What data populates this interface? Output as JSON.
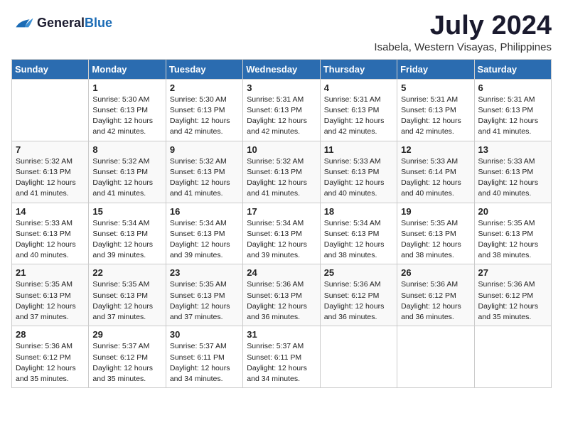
{
  "logo": {
    "line1": "General",
    "line2": "Blue"
  },
  "title": "July 2024",
  "location": "Isabela, Western Visayas, Philippines",
  "weekdays": [
    "Sunday",
    "Monday",
    "Tuesday",
    "Wednesday",
    "Thursday",
    "Friday",
    "Saturday"
  ],
  "weeks": [
    [
      {
        "day": "",
        "sunrise": "",
        "sunset": "",
        "daylight": ""
      },
      {
        "day": "1",
        "sunrise": "Sunrise: 5:30 AM",
        "sunset": "Sunset: 6:13 PM",
        "daylight": "Daylight: 12 hours and 42 minutes."
      },
      {
        "day": "2",
        "sunrise": "Sunrise: 5:30 AM",
        "sunset": "Sunset: 6:13 PM",
        "daylight": "Daylight: 12 hours and 42 minutes."
      },
      {
        "day": "3",
        "sunrise": "Sunrise: 5:31 AM",
        "sunset": "Sunset: 6:13 PM",
        "daylight": "Daylight: 12 hours and 42 minutes."
      },
      {
        "day": "4",
        "sunrise": "Sunrise: 5:31 AM",
        "sunset": "Sunset: 6:13 PM",
        "daylight": "Daylight: 12 hours and 42 minutes."
      },
      {
        "day": "5",
        "sunrise": "Sunrise: 5:31 AM",
        "sunset": "Sunset: 6:13 PM",
        "daylight": "Daylight: 12 hours and 42 minutes."
      },
      {
        "day": "6",
        "sunrise": "Sunrise: 5:31 AM",
        "sunset": "Sunset: 6:13 PM",
        "daylight": "Daylight: 12 hours and 41 minutes."
      }
    ],
    [
      {
        "day": "7",
        "sunrise": "Sunrise: 5:32 AM",
        "sunset": "Sunset: 6:13 PM",
        "daylight": "Daylight: 12 hours and 41 minutes."
      },
      {
        "day": "8",
        "sunrise": "Sunrise: 5:32 AM",
        "sunset": "Sunset: 6:13 PM",
        "daylight": "Daylight: 12 hours and 41 minutes."
      },
      {
        "day": "9",
        "sunrise": "Sunrise: 5:32 AM",
        "sunset": "Sunset: 6:13 PM",
        "daylight": "Daylight: 12 hours and 41 minutes."
      },
      {
        "day": "10",
        "sunrise": "Sunrise: 5:32 AM",
        "sunset": "Sunset: 6:13 PM",
        "daylight": "Daylight: 12 hours and 41 minutes."
      },
      {
        "day": "11",
        "sunrise": "Sunrise: 5:33 AM",
        "sunset": "Sunset: 6:13 PM",
        "daylight": "Daylight: 12 hours and 40 minutes."
      },
      {
        "day": "12",
        "sunrise": "Sunrise: 5:33 AM",
        "sunset": "Sunset: 6:14 PM",
        "daylight": "Daylight: 12 hours and 40 minutes."
      },
      {
        "day": "13",
        "sunrise": "Sunrise: 5:33 AM",
        "sunset": "Sunset: 6:13 PM",
        "daylight": "Daylight: 12 hours and 40 minutes."
      }
    ],
    [
      {
        "day": "14",
        "sunrise": "Sunrise: 5:33 AM",
        "sunset": "Sunset: 6:13 PM",
        "daylight": "Daylight: 12 hours and 40 minutes."
      },
      {
        "day": "15",
        "sunrise": "Sunrise: 5:34 AM",
        "sunset": "Sunset: 6:13 PM",
        "daylight": "Daylight: 12 hours and 39 minutes."
      },
      {
        "day": "16",
        "sunrise": "Sunrise: 5:34 AM",
        "sunset": "Sunset: 6:13 PM",
        "daylight": "Daylight: 12 hours and 39 minutes."
      },
      {
        "day": "17",
        "sunrise": "Sunrise: 5:34 AM",
        "sunset": "Sunset: 6:13 PM",
        "daylight": "Daylight: 12 hours and 39 minutes."
      },
      {
        "day": "18",
        "sunrise": "Sunrise: 5:34 AM",
        "sunset": "Sunset: 6:13 PM",
        "daylight": "Daylight: 12 hours and 38 minutes."
      },
      {
        "day": "19",
        "sunrise": "Sunrise: 5:35 AM",
        "sunset": "Sunset: 6:13 PM",
        "daylight": "Daylight: 12 hours and 38 minutes."
      },
      {
        "day": "20",
        "sunrise": "Sunrise: 5:35 AM",
        "sunset": "Sunset: 6:13 PM",
        "daylight": "Daylight: 12 hours and 38 minutes."
      }
    ],
    [
      {
        "day": "21",
        "sunrise": "Sunrise: 5:35 AM",
        "sunset": "Sunset: 6:13 PM",
        "daylight": "Daylight: 12 hours and 37 minutes."
      },
      {
        "day": "22",
        "sunrise": "Sunrise: 5:35 AM",
        "sunset": "Sunset: 6:13 PM",
        "daylight": "Daylight: 12 hours and 37 minutes."
      },
      {
        "day": "23",
        "sunrise": "Sunrise: 5:35 AM",
        "sunset": "Sunset: 6:13 PM",
        "daylight": "Daylight: 12 hours and 37 minutes."
      },
      {
        "day": "24",
        "sunrise": "Sunrise: 5:36 AM",
        "sunset": "Sunset: 6:13 PM",
        "daylight": "Daylight: 12 hours and 36 minutes."
      },
      {
        "day": "25",
        "sunrise": "Sunrise: 5:36 AM",
        "sunset": "Sunset: 6:12 PM",
        "daylight": "Daylight: 12 hours and 36 minutes."
      },
      {
        "day": "26",
        "sunrise": "Sunrise: 5:36 AM",
        "sunset": "Sunset: 6:12 PM",
        "daylight": "Daylight: 12 hours and 36 minutes."
      },
      {
        "day": "27",
        "sunrise": "Sunrise: 5:36 AM",
        "sunset": "Sunset: 6:12 PM",
        "daylight": "Daylight: 12 hours and 35 minutes."
      }
    ],
    [
      {
        "day": "28",
        "sunrise": "Sunrise: 5:36 AM",
        "sunset": "Sunset: 6:12 PM",
        "daylight": "Daylight: 12 hours and 35 minutes."
      },
      {
        "day": "29",
        "sunrise": "Sunrise: 5:37 AM",
        "sunset": "Sunset: 6:12 PM",
        "daylight": "Daylight: 12 hours and 35 minutes."
      },
      {
        "day": "30",
        "sunrise": "Sunrise: 5:37 AM",
        "sunset": "Sunset: 6:11 PM",
        "daylight": "Daylight: 12 hours and 34 minutes."
      },
      {
        "day": "31",
        "sunrise": "Sunrise: 5:37 AM",
        "sunset": "Sunset: 6:11 PM",
        "daylight": "Daylight: 12 hours and 34 minutes."
      },
      {
        "day": "",
        "sunrise": "",
        "sunset": "",
        "daylight": ""
      },
      {
        "day": "",
        "sunrise": "",
        "sunset": "",
        "daylight": ""
      },
      {
        "day": "",
        "sunrise": "",
        "sunset": "",
        "daylight": ""
      }
    ]
  ]
}
